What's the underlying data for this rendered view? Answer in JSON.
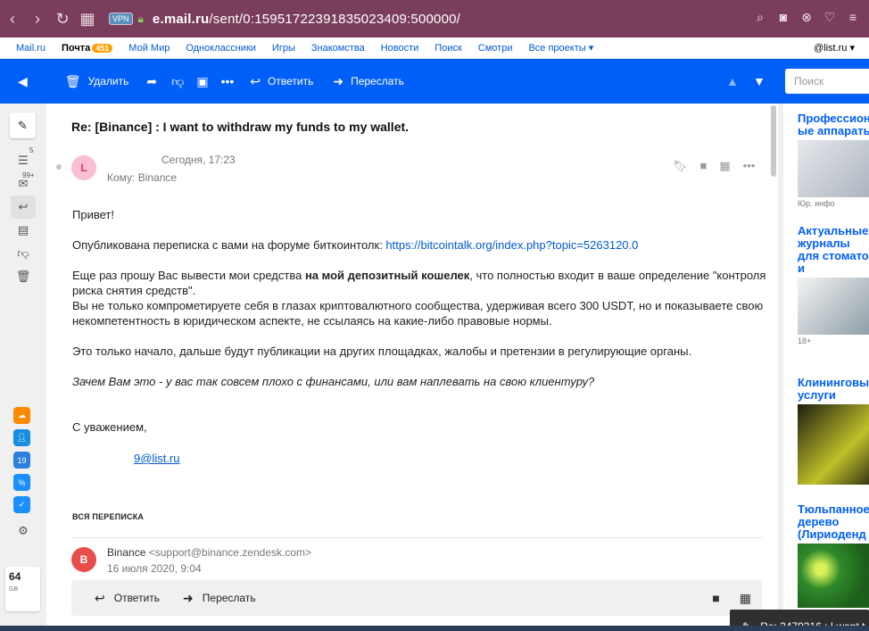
{
  "browser": {
    "vpn": "VPN",
    "url_domain": "e.mail.ru",
    "url_path": "/sent/0:15951722391835023409:500000/"
  },
  "portal": {
    "items": [
      "Mail.ru",
      "Почта",
      "Мой Мир",
      "Одноклассники",
      "Игры",
      "Знакомства",
      "Новости",
      "Поиск",
      "Смотри",
      "Все проекты ▾"
    ],
    "mail_badge": "451",
    "user": "@list.ru ▾"
  },
  "toolbar": {
    "delete": "Удалить",
    "reply": "Ответить",
    "forward": "Переслать",
    "search_placeholder": "Поиск"
  },
  "rail": {
    "inbox_count": "5",
    "sent_count": "99+",
    "calendar_day": "19",
    "disk_size": "64",
    "disk_unit": "GB"
  },
  "message": {
    "subject": "Re: [Binance]  :  I want to withdraw my funds to my wallet.",
    "avatar_letter": "L",
    "sender": "",
    "date": "Сегодня, 17:23",
    "to": "Кому: Binance",
    "greeting": "Привет!",
    "p1_text": "Опубликована переписка с вами на форуме биткоинтолк: ",
    "p1_link": "https://bitcointalk.org/index.php?topic=5263120.0",
    "p2_a": "Еще раз прошу Вас вывести мои средства ",
    "p2_bold": "на мой депозитный кошелек",
    "p2_b": ", что полностью входит в ваше определение \"контроля риска снятия средств\".",
    "p2_c": "Вы не только компрометируете себя в глазах криптовалютного сообщества, удерживая всего 300 USDT, но и показываете свою некомпетентность в юридическом аспекте, не ссылаясь на какие-либо правовые нормы.",
    "p3": "Это только начало, дальше будут публикации на других площадках, жалобы и претензии в регулирующие органы.",
    "p4": "Зачем Вам это - у вас так совсем плохо с финансами, или вам наплевать на свою клиентуру?",
    "sign": "С уважением,",
    "sign_email": "9@list.ru"
  },
  "thread": {
    "title": "ВСЯ ПЕРЕПИСКА",
    "avatar_letter": "B",
    "sender_name": "Binance",
    "sender_email": "<support@binance.zendesk.com>",
    "date": "16 июля 2020, 9:04"
  },
  "replybar": {
    "reply": "Ответить",
    "forward": "Переслать"
  },
  "toast": {
    "text": "Re: 3479316 : I want t"
  },
  "ads": [
    {
      "title": "Профессион\nые аппарать",
      "meta": "Юр. инфо",
      "color": "#cfd4dc"
    },
    {
      "title": "Актуальные\nжурналы\nдля стомато\nи",
      "meta": "18+",
      "color": "#b7c2c9"
    },
    {
      "title": "Клининговы\nуслуги",
      "meta": "",
      "color": "#4a4a12"
    },
    {
      "title": "Тюльпанное\nдерево\n(Лириоденд",
      "meta": "",
      "color": "#2f8a2b"
    }
  ]
}
